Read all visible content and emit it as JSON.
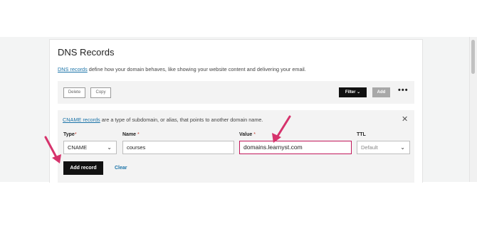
{
  "page": {
    "title": "DNS Records"
  },
  "description": {
    "link": "DNS records",
    "rest": " define how your domain behaves, like showing your website content and delivering your email."
  },
  "toolbar": {
    "delete": "Delete",
    "copy": "Copy",
    "filter": "Filter",
    "add": "Add",
    "more": "•••"
  },
  "form": {
    "note_link": "CNAME records",
    "note_rest": " are a type of subdomain, or alias, that points to another domain name.",
    "close": "✕",
    "labels": {
      "type": "Type",
      "name": "Name",
      "value": "Value",
      "ttl": "TTL",
      "required": "*"
    },
    "type_value": "CNAME",
    "name_value": "courses",
    "value_value": "domains.learnyst.com",
    "ttl_value": "Default",
    "add_record": "Add record",
    "clear": "Clear"
  },
  "colors": {
    "accent": "#1a73a8",
    "annotation": "#d6336c",
    "highlight": "#c2185b"
  },
  "icons": {
    "chevron": "chevron-down-icon",
    "close": "close-icon",
    "more": "more-horizontal-icon"
  }
}
